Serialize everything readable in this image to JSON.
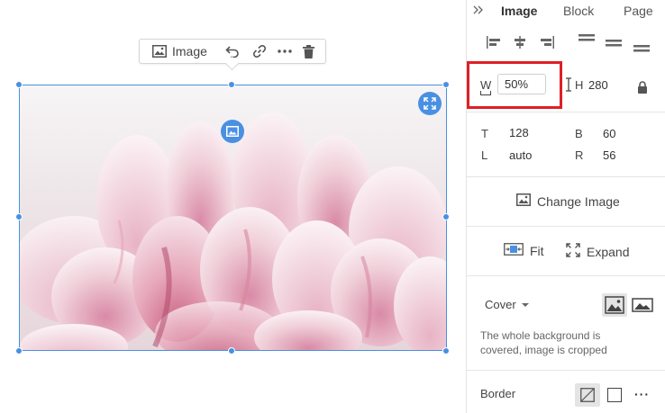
{
  "float_toolbar": {
    "label": "Image",
    "icons": [
      "image-icon",
      "undo-icon",
      "link-icon",
      "more-icon",
      "trash-icon"
    ]
  },
  "panel": {
    "tabs": [
      {
        "label": "Image",
        "active": true
      },
      {
        "label": "Block",
        "active": false
      },
      {
        "label": "Page",
        "active": false
      }
    ],
    "size": {
      "w_label": "W",
      "w_value": "50%",
      "h_label": "H",
      "h_value": "280"
    },
    "position": {
      "t_label": "T",
      "t_value": "128",
      "b_label": "B",
      "b_value": "60",
      "l_label": "L",
      "l_value": "auto",
      "r_label": "R",
      "r_value": "56"
    },
    "change_image_label": "Change Image",
    "fit_label": "Fit",
    "expand_label": "Expand",
    "cover": {
      "selected": "Cover",
      "description": "The whole background is covered, image is cropped"
    },
    "border_label": "Border"
  },
  "colors": {
    "accent": "#4a90e2",
    "highlight": "#e01f26"
  }
}
